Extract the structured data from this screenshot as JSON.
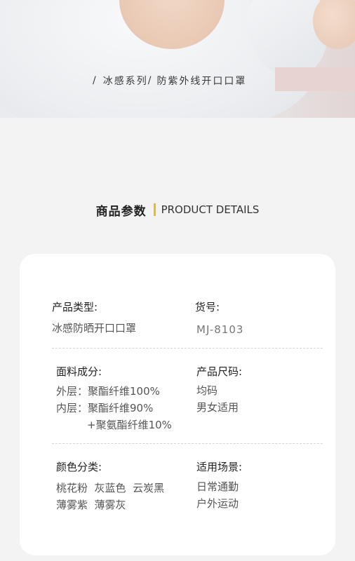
{
  "hero": {
    "caption_slash": "/",
    "caption_part1": "冰感系列",
    "caption_sep": "/",
    "caption_part2": "防紫外线开口口罩"
  },
  "section": {
    "title_cn": "商品参数",
    "title_en": "PRODUCT DETAILS",
    "accent_color": "#f2b81c"
  },
  "details": {
    "product_type": {
      "label": "产品类型:",
      "value": "冰感防晒开口口罩"
    },
    "item_no": {
      "label": "货号:",
      "value": "MJ-8103"
    },
    "material": {
      "label": "面料成分:",
      "lines": [
        "外层：聚酯纤维100%",
        "内层：聚酯纤维90%",
        "+聚氨酯纤维10%"
      ]
    },
    "size": {
      "label": "产品尺码:",
      "lines": [
        "均码",
        "男女适用"
      ]
    },
    "colors": {
      "label": "颜色分类:",
      "lines": [
        "桃花粉  灰蓝色  云炭黑",
        "薄雾紫  薄雾灰"
      ]
    },
    "scenes": {
      "label": "适用场景:",
      "lines": [
        "日常通勤",
        "户外运动"
      ]
    }
  }
}
